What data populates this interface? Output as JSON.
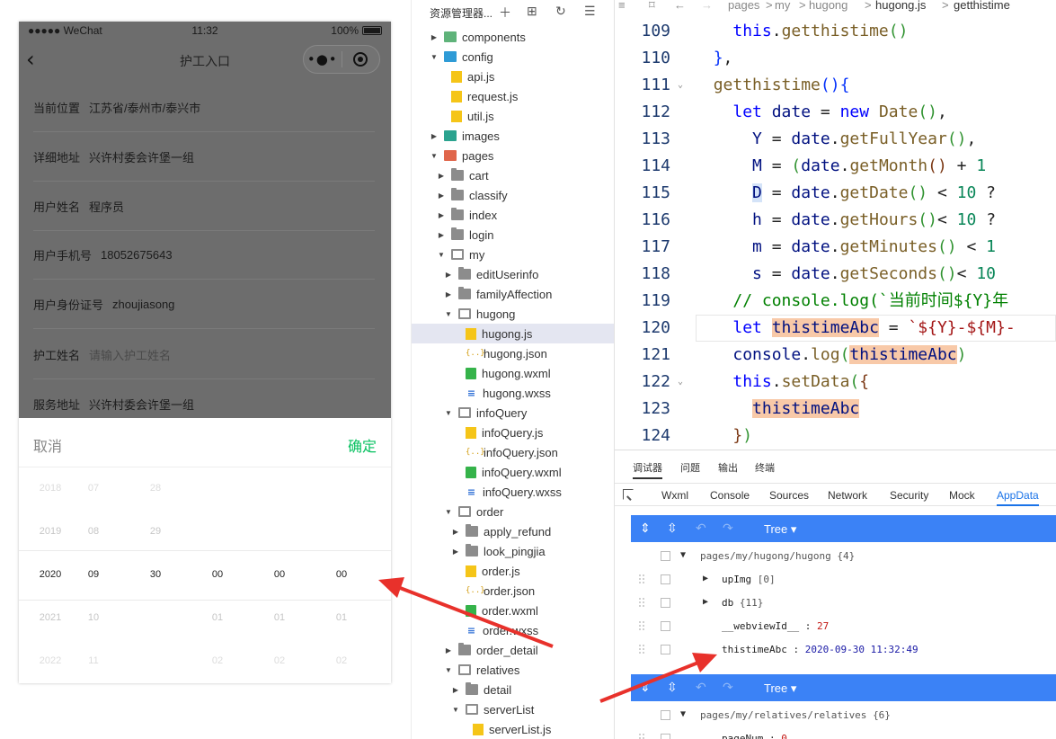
{
  "simulator": {
    "status": {
      "carrier": "●●●●● WeChat",
      "time": "11:32",
      "battery": "100%"
    },
    "nav": {
      "back_icon": "back-chevron-icon",
      "title": "护工入口",
      "more_icon": "more-dots-icon",
      "close_icon": "target-close-icon"
    },
    "form": [
      {
        "label": "当前位置",
        "value": "江苏省/泰州市/泰兴市",
        "placeholder": false
      },
      {
        "label": "详细地址",
        "value": "兴许村委会许堡一组",
        "placeholder": false
      },
      {
        "label": "用户姓名",
        "value": "程序员",
        "placeholder": false
      },
      {
        "label": "用户手机号",
        "value": "18052675643",
        "placeholder": false
      },
      {
        "label": "用户身份证号",
        "value": "zhoujiasong",
        "placeholder": false
      },
      {
        "label": "护工姓名",
        "value": "请输入护工姓名",
        "placeholder": true
      },
      {
        "label": "服务地址",
        "value": "兴许村委会许堡一组",
        "placeholder": false
      }
    ],
    "picker": {
      "cancel": "取消",
      "confirm": "确定",
      "rows": [
        [
          "2018",
          "07",
          "28",
          "",
          "",
          ""
        ],
        [
          "2019",
          "08",
          "29",
          "",
          "",
          ""
        ],
        [
          "2020",
          "09",
          "30",
          "00",
          "00",
          "00"
        ],
        [
          "2021",
          "10",
          "",
          "01",
          "01",
          "01"
        ],
        [
          "2022",
          "11",
          "",
          "02",
          "02",
          "02"
        ]
      ]
    }
  },
  "explorer": {
    "title": "资源管理器...",
    "toolbar_icons": [
      "new-file-icon",
      "new-folder-icon",
      "refresh-icon",
      "collapse-icon"
    ],
    "items": [
      {
        "label": "components",
        "depth": 0,
        "arrow": "▶",
        "icon": "folder-special"
      },
      {
        "label": "config",
        "depth": 0,
        "arrow": "▼",
        "icon": "folder-config"
      },
      {
        "label": "api.js",
        "depth": 1,
        "arrow": "",
        "icon": "js"
      },
      {
        "label": "request.js",
        "depth": 1,
        "arrow": "",
        "icon": "js"
      },
      {
        "label": "util.js",
        "depth": 1,
        "arrow": "",
        "icon": "js"
      },
      {
        "label": "images",
        "depth": 0,
        "arrow": "▶",
        "icon": "folder-images"
      },
      {
        "label": "pages",
        "depth": 0,
        "arrow": "▼",
        "icon": "folder-pages"
      },
      {
        "label": "cart",
        "depth": 1,
        "arrow": "▶",
        "icon": "folder"
      },
      {
        "label": "classify",
        "depth": 1,
        "arrow": "▶",
        "icon": "folder"
      },
      {
        "label": "index",
        "depth": 1,
        "arrow": "▶",
        "icon": "folder"
      },
      {
        "label": "login",
        "depth": 1,
        "arrow": "▶",
        "icon": "folder"
      },
      {
        "label": "my",
        "depth": 1,
        "arrow": "▼",
        "icon": "folder-open"
      },
      {
        "label": "editUserinfo",
        "depth": 2,
        "arrow": "▶",
        "icon": "folder"
      },
      {
        "label": "familyAffection",
        "depth": 2,
        "arrow": "▶",
        "icon": "folder"
      },
      {
        "label": "hugong",
        "depth": 2,
        "arrow": "▼",
        "icon": "folder-open"
      },
      {
        "label": "hugong.js",
        "depth": 3,
        "arrow": "",
        "icon": "js",
        "selected": true
      },
      {
        "label": "hugong.json",
        "depth": 3,
        "arrow": "",
        "icon": "json"
      },
      {
        "label": "hugong.wxml",
        "depth": 3,
        "arrow": "",
        "icon": "wxml"
      },
      {
        "label": "hugong.wxss",
        "depth": 3,
        "arrow": "",
        "icon": "wxss"
      },
      {
        "label": "infoQuery",
        "depth": 2,
        "arrow": "▼",
        "icon": "folder-open"
      },
      {
        "label": "infoQuery.js",
        "depth": 3,
        "arrow": "",
        "icon": "js"
      },
      {
        "label": "infoQuery.json",
        "depth": 3,
        "arrow": "",
        "icon": "json"
      },
      {
        "label": "infoQuery.wxml",
        "depth": 3,
        "arrow": "",
        "icon": "wxml"
      },
      {
        "label": "infoQuery.wxss",
        "depth": 3,
        "arrow": "",
        "icon": "wxss"
      },
      {
        "label": "order",
        "depth": 2,
        "arrow": "▼",
        "icon": "folder-open"
      },
      {
        "label": "apply_refund",
        "depth": 3,
        "arrow": "▶",
        "icon": "folder"
      },
      {
        "label": "look_pingjia",
        "depth": 3,
        "arrow": "▶",
        "icon": "folder"
      },
      {
        "label": "order.js",
        "depth": 3,
        "arrow": "",
        "icon": "js"
      },
      {
        "label": "order.json",
        "depth": 3,
        "arrow": "",
        "icon": "json"
      },
      {
        "label": "order.wxml",
        "depth": 3,
        "arrow": "",
        "icon": "wxml"
      },
      {
        "label": "order.wxss",
        "depth": 3,
        "arrow": "",
        "icon": "wxss"
      },
      {
        "label": "order_detail",
        "depth": 2,
        "arrow": "▶",
        "icon": "folder"
      },
      {
        "label": "relatives",
        "depth": 2,
        "arrow": "▼",
        "icon": "folder-open"
      },
      {
        "label": "detail",
        "depth": 3,
        "arrow": "▶",
        "icon": "folder"
      },
      {
        "label": "serverList",
        "depth": 3,
        "arrow": "▼",
        "icon": "folder-open"
      },
      {
        "label": "serverList.js",
        "depth": 4,
        "arrow": "",
        "icon": "js"
      }
    ]
  },
  "editor": {
    "breadcrumb": [
      "pages",
      ">",
      "my",
      ">",
      "hugong",
      ">",
      "hugong.js",
      ">",
      "getthistime"
    ],
    "lines": [
      {
        "n": "109",
        "fold": "",
        "html": "    <span class=\"k\">this</span>.<span class=\"fn\">getthistime</span><span class=\"p2\">()</span>"
      },
      {
        "n": "110",
        "fold": "",
        "html": "  <span class=\"p1\">}</span>,"
      },
      {
        "n": "111",
        "fold": "⌄",
        "html": "  <span class=\"fn\">getthistime</span><span class=\"p1\">()</span><span class=\"p1\">{</span>"
      },
      {
        "n": "112",
        "fold": "",
        "html": "    <span class=\"k\">let</span> <span class=\"ident\">date</span> = <span class=\"k\">new</span> <span class=\"fn\">Date</span><span class=\"p2\">()</span>,"
      },
      {
        "n": "113",
        "fold": "",
        "html": "      <span class=\"ident\">Y</span> = <span class=\"ident\">date</span>.<span class=\"fn\">getFullYear</span><span class=\"p2\">()</span>,"
      },
      {
        "n": "114",
        "fold": "",
        "html": "      <span class=\"ident\">M</span> = <span class=\"p2\">(</span><span class=\"ident\">date</span>.<span class=\"fn\">getMonth</span><span class=\"p3\">()</span> + <span class=\"num\">1</span>"
      },
      {
        "n": "115",
        "fold": "",
        "html": "      <span class=\"ident cur\">D</span> = <span class=\"ident\">date</span>.<span class=\"fn\">getDate</span><span class=\"p2\">()</span> &lt; <span class=\"num\">10</span> ?"
      },
      {
        "n": "116",
        "fold": "",
        "html": "      <span class=\"ident\">h</span> = <span class=\"ident\">date</span>.<span class=\"fn\">getHours</span><span class=\"p2\">()</span>&lt; <span class=\"num\">10</span> ?"
      },
      {
        "n": "117",
        "fold": "",
        "html": "      <span class=\"ident\">m</span> = <span class=\"ident\">date</span>.<span class=\"fn\">getMinutes</span><span class=\"p2\">()</span> &lt; <span class=\"num\">1</span>"
      },
      {
        "n": "118",
        "fold": "",
        "html": "      <span class=\"ident\">s</span> = <span class=\"ident\">date</span>.<span class=\"fn\">getSeconds</span><span class=\"p2\">()</span>&lt; <span class=\"num\">10</span>"
      },
      {
        "n": "119",
        "fold": "",
        "html": "    <span class=\"cm\">// console.log(`当前时间${Y}年</span>"
      },
      {
        "n": "120",
        "fold": "",
        "html": "    <span class=\"k\">let</span> <span class=\"ident hl\">thistimeAbc</span> = <span class=\"str\">`${Y}-${M}-</span>"
      },
      {
        "n": "121",
        "fold": "",
        "html": "    <span class=\"ident\">console</span>.<span class=\"fn\">log</span><span class=\"p2\">(</span><span class=\"ident hl\">thistimeAbc</span><span class=\"p2\">)</span>"
      },
      {
        "n": "122",
        "fold": "⌄",
        "html": "    <span class=\"k\">this</span>.<span class=\"fn\">setData</span><span class=\"p2\">(</span><span class=\"p3\">{</span>"
      },
      {
        "n": "123",
        "fold": "",
        "html": "      <span class=\"ident hl\">thistimeAbc</span>"
      },
      {
        "n": "124",
        "fold": "",
        "html": "    <span class=\"p3\">}</span><span class=\"p2\">)</span>"
      }
    ]
  },
  "debugger": {
    "tabs": [
      "调试器",
      "问题",
      "输出",
      "终端"
    ],
    "devtools_tabs": [
      "Wxml",
      "Console",
      "Sources",
      "Network",
      "Security",
      "Mock",
      "AppData"
    ],
    "tree_label": "Tree ▾",
    "panels": [
      {
        "page": "pages/my/hugong/hugong",
        "count": "{4}",
        "rows": [
          {
            "key": "upImg",
            "value": "[0]",
            "kind": "type",
            "expandable": true
          },
          {
            "key": "db",
            "value": "{11}",
            "kind": "type",
            "expandable": true
          },
          {
            "key": "__webviewId__",
            "value": "27",
            "kind": "num",
            "expandable": false
          },
          {
            "key": "thistimeAbc",
            "value": "2020-09-30 11:32:49",
            "kind": "str",
            "expandable": false
          }
        ]
      },
      {
        "page": "pages/my/relatives/relatives",
        "count": "{6}",
        "rows": [
          {
            "key": "pageNum",
            "value": "0",
            "kind": "num",
            "expandable": false
          }
        ]
      }
    ]
  },
  "colors": {
    "confirm_green": "#07c160",
    "appdata_blue": "#3b82f6",
    "arrow_red": "#e8312b",
    "token_highlight": "#f8c9a8"
  }
}
